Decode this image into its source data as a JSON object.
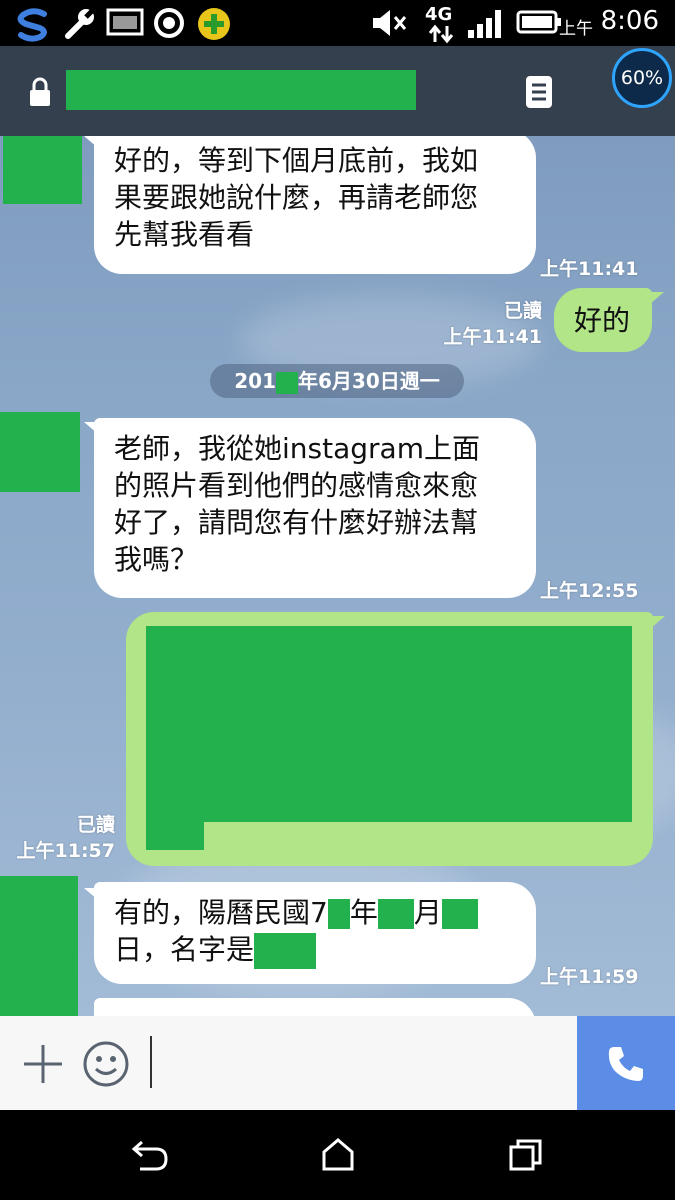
{
  "status_bar": {
    "network": "4G",
    "ampm": "上午",
    "time": "8:06",
    "battery_badge": "60%"
  },
  "messages": [
    {
      "side": "left",
      "text": [
        "好的，等到下個月底前，我如",
        "果要跟她說什麼，再請老師您",
        "先幫我看看"
      ],
      "time": "上午11:41"
    },
    {
      "side": "right",
      "text": "好的",
      "read": "已讀",
      "time": "上午11:41"
    },
    {
      "side": "left",
      "text": [
        "老師，我從她instagram上面",
        "的照片看到他們的感情愈來愈",
        "好了，請問您有什麼好辦法幫",
        "我嗎？"
      ],
      "time": "上午12:55"
    },
    {
      "side": "right",
      "read": "已讀",
      "time": "上午11:57"
    },
    {
      "side": "left",
      "text_parts": {
        "l1a": "有的，陽曆民國7",
        "l1b": "年",
        "l1c": "月",
        "l2": "日，名字是"
      },
      "time": "上午11:59"
    }
  ],
  "date_separator": {
    "prefix": "201",
    "suffix": "年6月30日週一"
  },
  "colors": {
    "redaction": "#22b14c",
    "header": "#35404f",
    "bubble_right": "#b2e587",
    "call_button": "#5b8de6"
  },
  "icons": [
    "s-app-icon",
    "wrench-icon",
    "image-icon",
    "record-icon",
    "game-icon",
    "mute-icon",
    "signal-icon",
    "battery-icon",
    "lock-icon",
    "menu-icon",
    "plus-icon",
    "emoji-icon",
    "phone-icon",
    "back-icon",
    "home-icon",
    "recents-icon"
  ]
}
